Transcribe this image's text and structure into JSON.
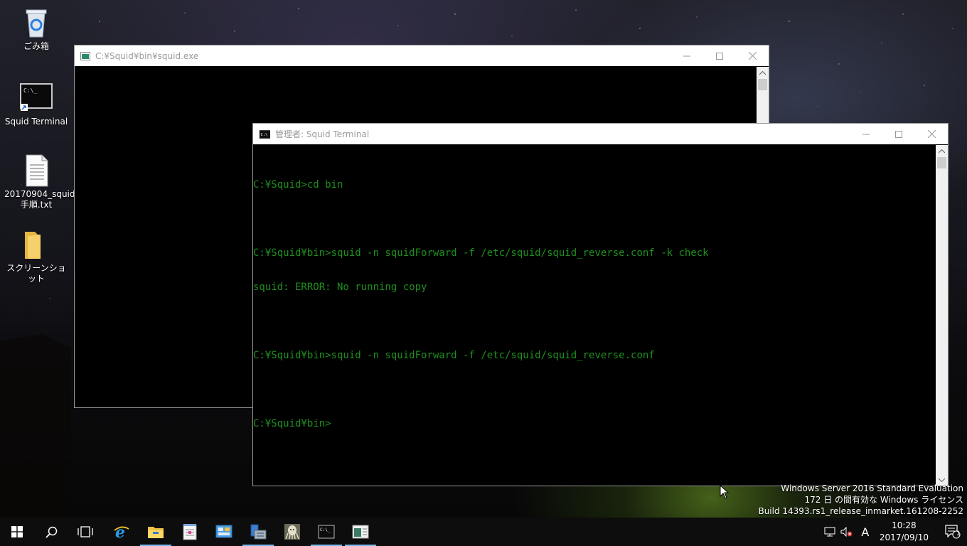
{
  "desktop": {
    "icons": [
      {
        "label": "ごみ箱",
        "icon": "recycle-bin-icon"
      },
      {
        "label": "Squid Terminal",
        "icon": "terminal-shortcut-icon"
      },
      {
        "label": "20170904_squid手順.txt",
        "icon": "text-file-icon"
      },
      {
        "label": "スクリーンショット",
        "icon": "folder-icon"
      }
    ]
  },
  "back_window": {
    "title": "C:¥Squid¥bin¥squid.exe"
  },
  "front_window": {
    "title": "管理者: Squid Terminal",
    "lines": [
      "C:¥Squid>cd bin",
      "",
      "C:¥Squid¥bin>squid -n squidForward -f /etc/squid/squid_reverse.conf -k check",
      "squid: ERROR: No running copy",
      "",
      "C:¥Squid¥bin>squid -n squidForward -f /etc/squid/squid_reverse.conf",
      "",
      "C:¥Squid¥bin>"
    ],
    "text_color": "#1e8f1e"
  },
  "watermark": {
    "line1": "Windows Server 2016 Standard Evaluation",
    "line2": "172 日 の間有効な Windows ライセンス",
    "line3": "Build 14393.rs1_release_inmarket.161208-2252"
  },
  "taskbar": {
    "apps": [
      {
        "icon": "ie-icon",
        "active": false
      },
      {
        "icon": "file-explorer-icon",
        "active": true
      },
      {
        "icon": "notepad-icon",
        "active": false
      },
      {
        "icon": "control-panel-icon",
        "active": false
      },
      {
        "icon": "server-manager-icon",
        "active": true
      },
      {
        "icon": "squid-icon",
        "active": false
      },
      {
        "icon": "cmd-icon",
        "active": true
      },
      {
        "icon": "console-window-icon",
        "active": true
      }
    ],
    "ime": "A",
    "time": "10:28",
    "date": "2017/09/10",
    "notification_count": "1"
  }
}
